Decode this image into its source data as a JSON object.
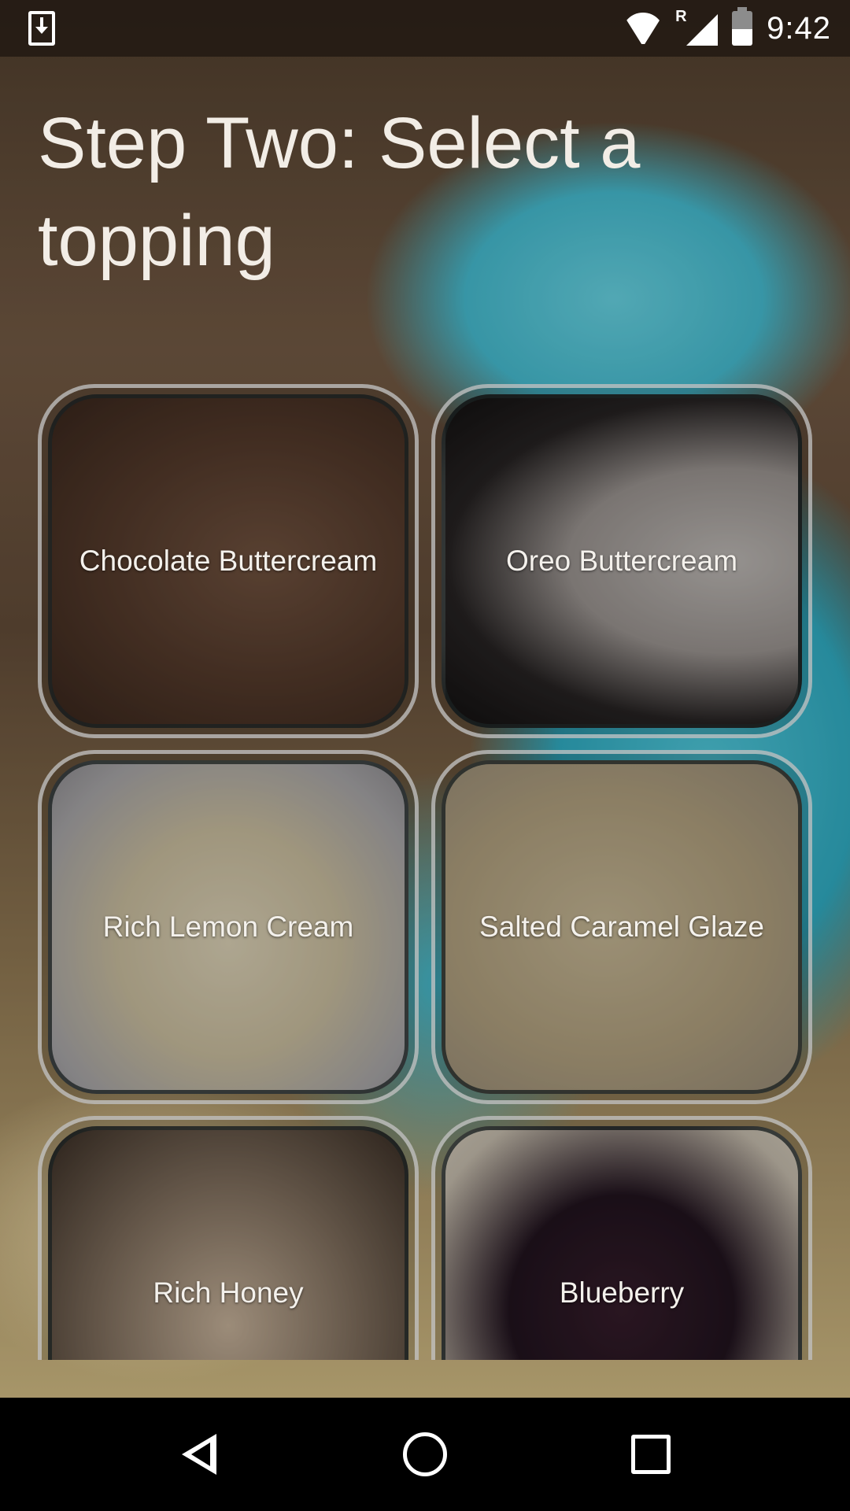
{
  "status_bar": {
    "time": "9:42",
    "network_badge": "R",
    "icons": [
      "download-icon",
      "wifi-icon",
      "signal-icon",
      "battery-icon"
    ]
  },
  "title": "Step Two: Select a topping",
  "toppings": [
    {
      "label": "Chocolate Buttercream"
    },
    {
      "label": "Oreo Buttercream"
    },
    {
      "label": "Rich Lemon Cream"
    },
    {
      "label": "Salted Caramel Glaze"
    },
    {
      "label": "Rich Honey"
    },
    {
      "label": "Blueberry"
    }
  ],
  "nav_bar": {
    "icons": [
      "back-icon",
      "home-icon",
      "recents-icon"
    ]
  }
}
